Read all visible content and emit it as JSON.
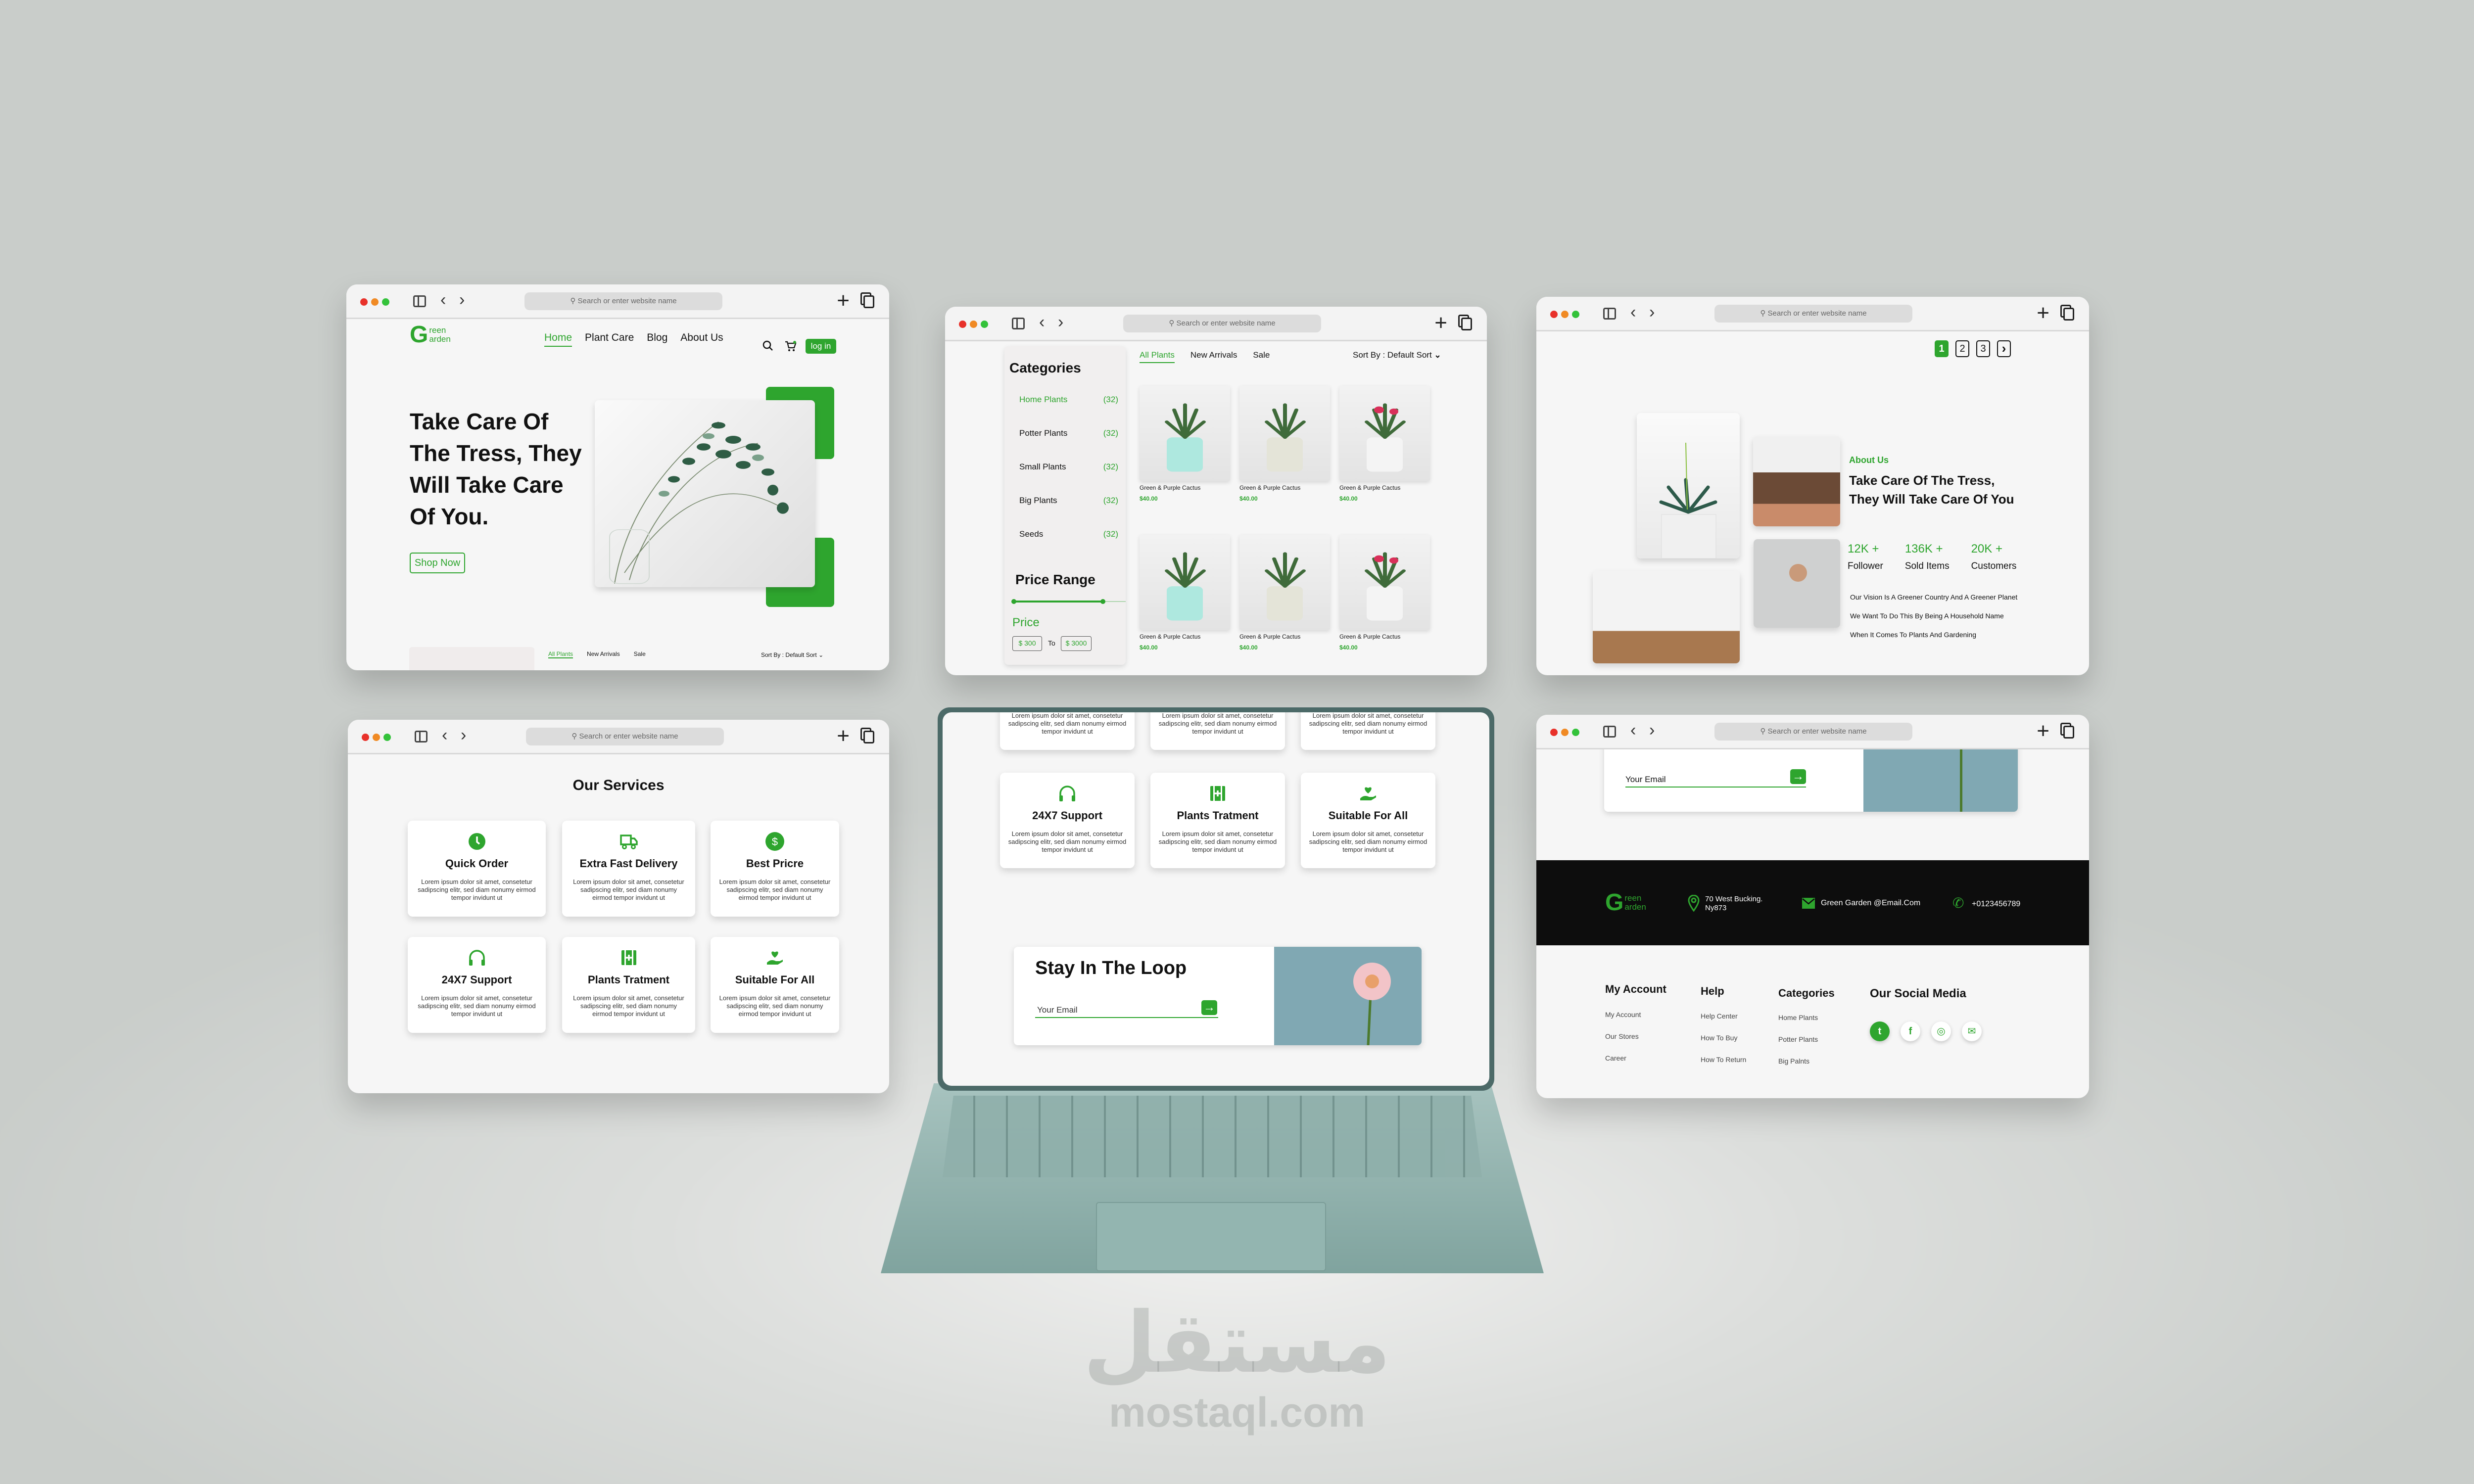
{
  "browser": {
    "url_placeholder": "Search or enter website name",
    "back": "‹",
    "forward": "›",
    "new_tab": "+"
  },
  "brand": {
    "initial": "G",
    "line1": "reen",
    "line2": "arden"
  },
  "colors": {
    "accent": "#2ea52e",
    "footer_band": "#0d0d0d",
    "laptop": "#8fb3ae"
  },
  "home": {
    "nav": [
      "Home",
      "Plant Care",
      "Blog",
      "About Us"
    ],
    "active_nav": "Home",
    "login": "log in",
    "hero_lines": [
      "Take Care Of",
      "The Tress, They",
      "Will Take Care",
      "Of You."
    ],
    "shop_now": "Shop Now",
    "tabs": [
      "All Plants",
      "New Arrivals",
      "Sale"
    ],
    "sort": "Sort By : Default Sort"
  },
  "shop": {
    "categories_title": "Categories",
    "categories": [
      {
        "name": "Home Plants",
        "count": "(32)"
      },
      {
        "name": "Potter Plants",
        "count": "(32)"
      },
      {
        "name": "Small Plants",
        "count": "(32)"
      },
      {
        "name": "Big Plants",
        "count": "(32)"
      },
      {
        "name": "Seeds",
        "count": "(32)"
      }
    ],
    "price_range_title": "Price Range",
    "price_label": "Price",
    "price_min": "$ 300",
    "price_to": "To",
    "price_max": "$ 3000",
    "tabs": [
      "All Plants",
      "New Arrivals",
      "Sale"
    ],
    "sort": "Sort By : Default Sort",
    "products": [
      {
        "name": "Green & Purple Cactus",
        "price": "$40.00",
        "pot": "#aee8df"
      },
      {
        "name": "Green & Purple Cactus",
        "price": "$40.00",
        "pot": "#e4e4d8"
      },
      {
        "name": "Green & Purple Cactus",
        "price": "$40.00",
        "pot": "#f4f4f4"
      },
      {
        "name": "Green & Purple Cactus",
        "price": "$40.00",
        "pot": "#aee8df"
      },
      {
        "name": "Green & Purple Cactus",
        "price": "$40.00",
        "pot": "#e4e4d8"
      },
      {
        "name": "Green & Purple Cactus",
        "price": "$40.00",
        "pot": "#f4f4f4"
      }
    ]
  },
  "about": {
    "pages": [
      "1",
      "2",
      "3"
    ],
    "next": "›",
    "label": "About Us",
    "title_lines": [
      "Take Care Of The Tress,",
      "They Will Take Care Of You"
    ],
    "stats": [
      {
        "value": "12K +",
        "label": "Follower"
      },
      {
        "value": "136K +",
        "label": "Sold Items"
      },
      {
        "value": "20K +",
        "label": "Customers"
      }
    ],
    "lines": [
      "Our Vision Is A Greener Country And A Greener Planet",
      "We Want To Do This By Being A Household Name",
      "When It Comes To Plants And Gardening"
    ]
  },
  "services": {
    "title": "Our Services",
    "items": [
      {
        "title": "Quick Order",
        "icon": "clock-icon",
        "desc": "Lorem ipsum dolor sit amet, consetetur sadipscing elitr, sed diam nonumy eirmod tempor invidunt ut"
      },
      {
        "title": "Extra Fast Delivery",
        "icon": "truck-icon",
        "desc": "Lorem ipsum dolor sit amet, consetetur sadipscing elitr, sed diam nonumy eirmod tempor invidunt ut"
      },
      {
        "title": "Best Pricre",
        "icon": "dollar-icon",
        "desc": "Lorem ipsum dolor sit amet, consetetur sadipscing elitr, sed diam nonumy eirmod tempor invidunt ut"
      },
      {
        "title": "24X7 Support",
        "icon": "headphones-icon",
        "desc": "Lorem ipsum dolor sit amet, consetetur sadipscing elitr, sed diam nonumy eirmod tempor invidunt ut"
      },
      {
        "title": "Plants Tratment",
        "icon": "medkit-icon",
        "desc": "Lorem ipsum dolor sit amet, consetetur sadipscing elitr, sed diam nonumy eirmod tempor invidunt ut"
      },
      {
        "title": "Suitable For All",
        "icon": "heart-hand-icon",
        "desc": "Lorem ipsum dolor sit amet, consetetur sadipscing elitr, sed diam nonumy eirmod tempor invidunt ut"
      }
    ]
  },
  "newsletter": {
    "title": "Stay In The Loop",
    "placeholder": "Your Email"
  },
  "footer": {
    "address_line1": "70 West Bucking.",
    "address_line2": "Ny873",
    "email": "Green Garden @Email.Com",
    "phone": "+0123456789",
    "columns": [
      {
        "title": "My Account",
        "links": [
          "My Account",
          "Our Stores",
          "Career"
        ]
      },
      {
        "title": "Help",
        "links": [
          "Help Center",
          "How To Buy",
          "How To Return"
        ]
      },
      {
        "title": "Categories",
        "links": [
          "Home Plants",
          "Potter Plants",
          "Big Palnts"
        ]
      }
    ],
    "social_title": "Our Social Media",
    "social": [
      "twitter-icon",
      "facebook-icon",
      "instagram-icon",
      "mail-icon"
    ]
  },
  "watermark": {
    "arabic": "مستقل",
    "latin": "mostaql.com"
  }
}
